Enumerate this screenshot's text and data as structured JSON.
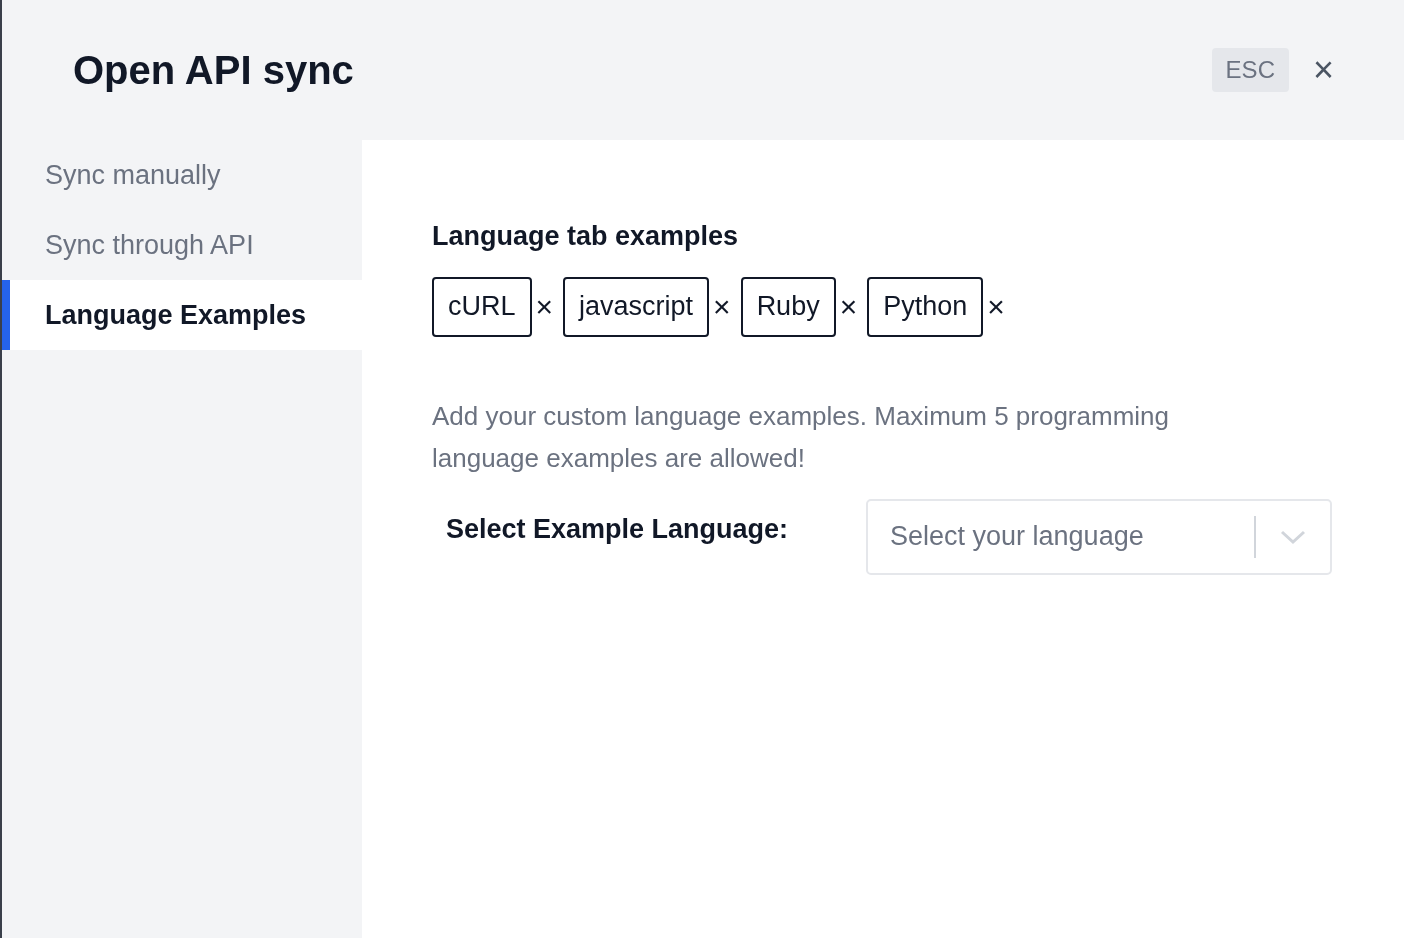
{
  "dialog": {
    "title": "Open API sync",
    "esc_label": "ESC",
    "close_glyph": "×"
  },
  "sidebar": {
    "items": [
      {
        "label": "Sync manually",
        "selected": false
      },
      {
        "label": "Sync through API",
        "selected": false
      },
      {
        "label": "Language Examples",
        "selected": true
      }
    ]
  },
  "content": {
    "heading": "Language tab examples",
    "tags": [
      {
        "label": "cURL",
        "remove_glyph": "×"
      },
      {
        "label": "javascript",
        "remove_glyph": "×"
      },
      {
        "label": "Ruby",
        "remove_glyph": "×"
      },
      {
        "label": "Python",
        "remove_glyph": "×"
      }
    ],
    "help_text": "Add your custom language examples. Maximum 5 programming language examples are allowed!",
    "select_label": "Select Example Language:",
    "select": {
      "placeholder": "Select your language"
    }
  }
}
